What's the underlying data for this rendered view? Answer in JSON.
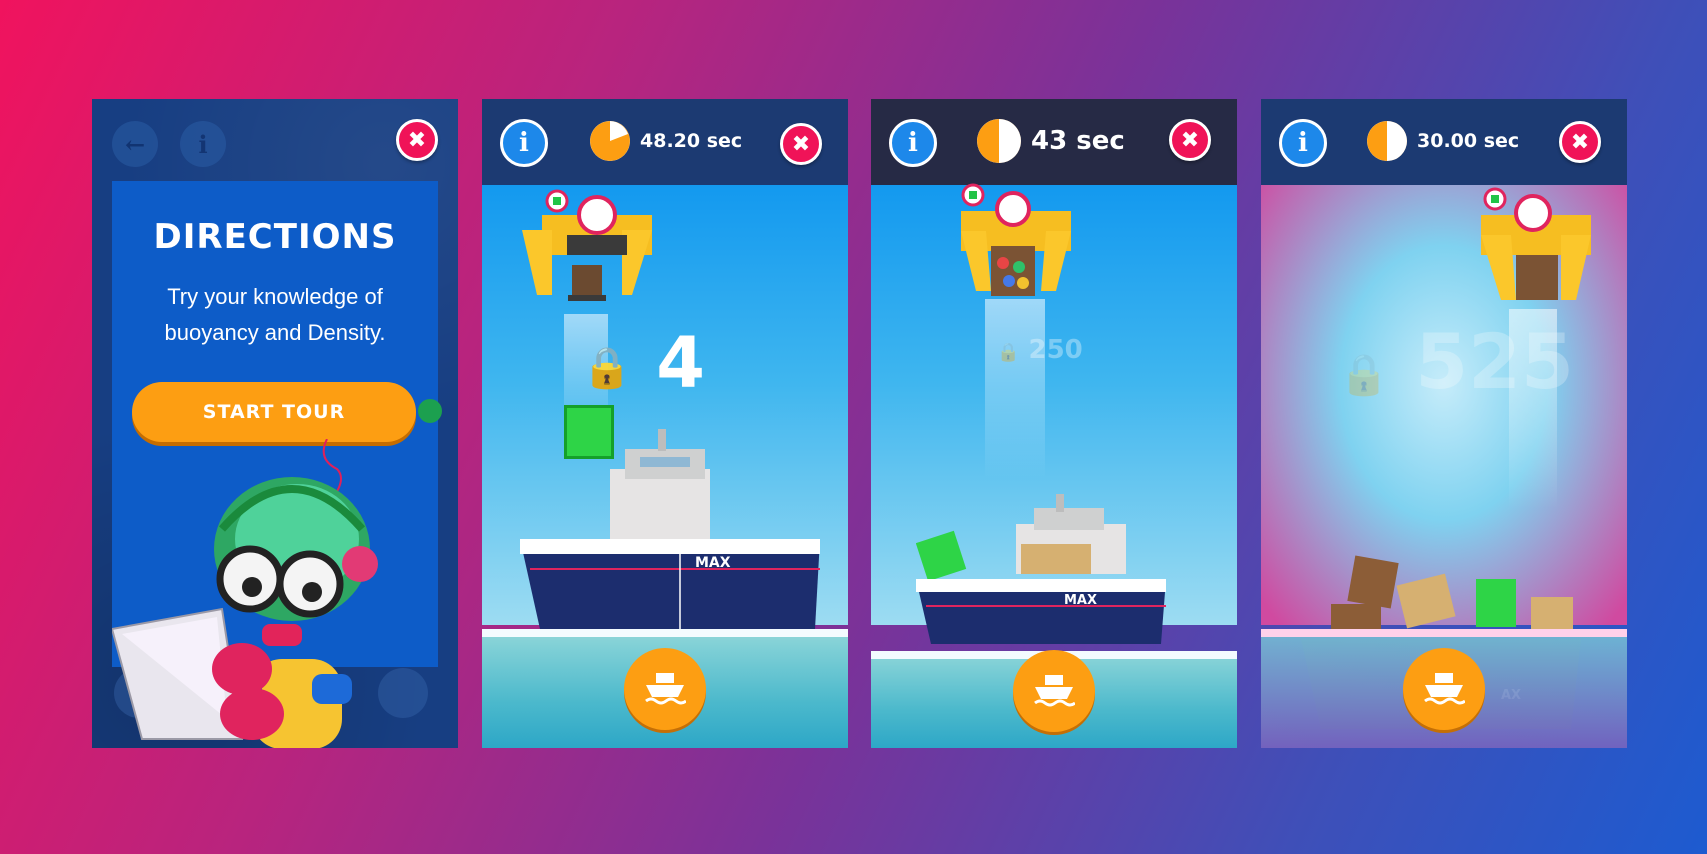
{
  "directions_screen": {
    "title": "DIRECTIONS",
    "text": "Try your knowledge of buoyancy and Density.",
    "start_button": "START TOUR",
    "back_icon": "arrow-left-icon",
    "info_icon": "info-icon",
    "close_icon": "close-icon",
    "close_glyph": "✖"
  },
  "game_screens": [
    {
      "info_glyph": "i",
      "timer": "48.20 sec",
      "weight_value": "4",
      "ship_label": "MAX",
      "close_glyph": "✖"
    },
    {
      "info_glyph": "i",
      "timer": "43 sec",
      "weight_value": "250",
      "ship_label": "MAX",
      "close_glyph": "✖"
    },
    {
      "info_glyph": "i",
      "timer": "30.00 sec",
      "weight_value": "525",
      "ship_label": "AX",
      "close_glyph": "✖"
    }
  ],
  "colors": {
    "close_red": "#f01358",
    "info_blue": "#1d88ea",
    "accent_orange": "#fd9e12",
    "directions_blue": "#0d5cc8"
  }
}
